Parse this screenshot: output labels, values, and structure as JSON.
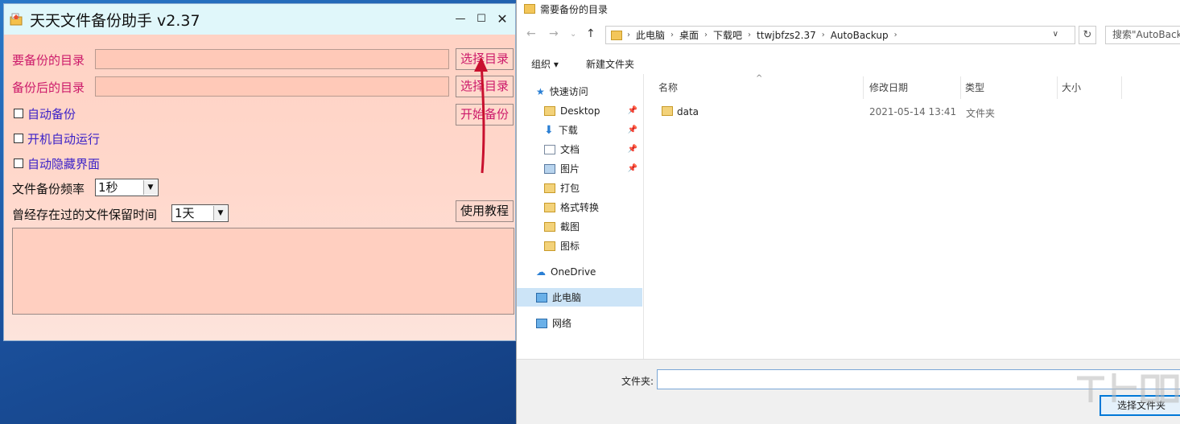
{
  "app": {
    "title": "天天文件备份助手 v2.37",
    "source_dir_label": "要备份的目录",
    "target_dir_label": "备份后的目录",
    "choose_dir_1": "选择目录",
    "choose_dir_2": "选择目录",
    "start_backup": "开始备份",
    "auto_backup": "自动备份",
    "auto_start": "开机自动运行",
    "auto_hide": "自动隐藏界面",
    "frequency_label": "文件备份频率",
    "frequency_value": "1秒",
    "retention_label": "曾经存在过的文件保留时间",
    "retention_value": "1天",
    "tutorial": "使用教程"
  },
  "dialog": {
    "title": "需要备份的目录",
    "breadcrumbs": [
      "此电脑",
      "桌面",
      "下载吧",
      "ttwjbfzs2.37",
      "AutoBackup"
    ],
    "search_placeholder": "搜索\"AutoBackup\"",
    "organize": "组织 ▾",
    "new_folder": "新建文件夹",
    "nav": {
      "quick_access": "快速访问",
      "desktop": "Desktop",
      "downloads": "下载",
      "documents": "文档",
      "pictures": "图片",
      "pack": "打包",
      "format": "格式转换",
      "screenshots": "截图",
      "icons": "图标",
      "onedrive": "OneDrive",
      "this_pc": "此电脑",
      "network": "网络"
    },
    "columns": {
      "name": "名称",
      "modified": "修改日期",
      "type": "类型",
      "size": "大小"
    },
    "files": [
      {
        "name": "data",
        "modified": "2021-05-14 13:41",
        "type": "文件夹"
      }
    ],
    "folder_label": "文件夹:",
    "folder_value": "",
    "select_button": "选择文件夹"
  },
  "colors": {
    "accent": "#0078d7",
    "app_bg": "#ffd2c4",
    "label_red": "#cc1a6a",
    "label_blue": "#3b22c8"
  }
}
